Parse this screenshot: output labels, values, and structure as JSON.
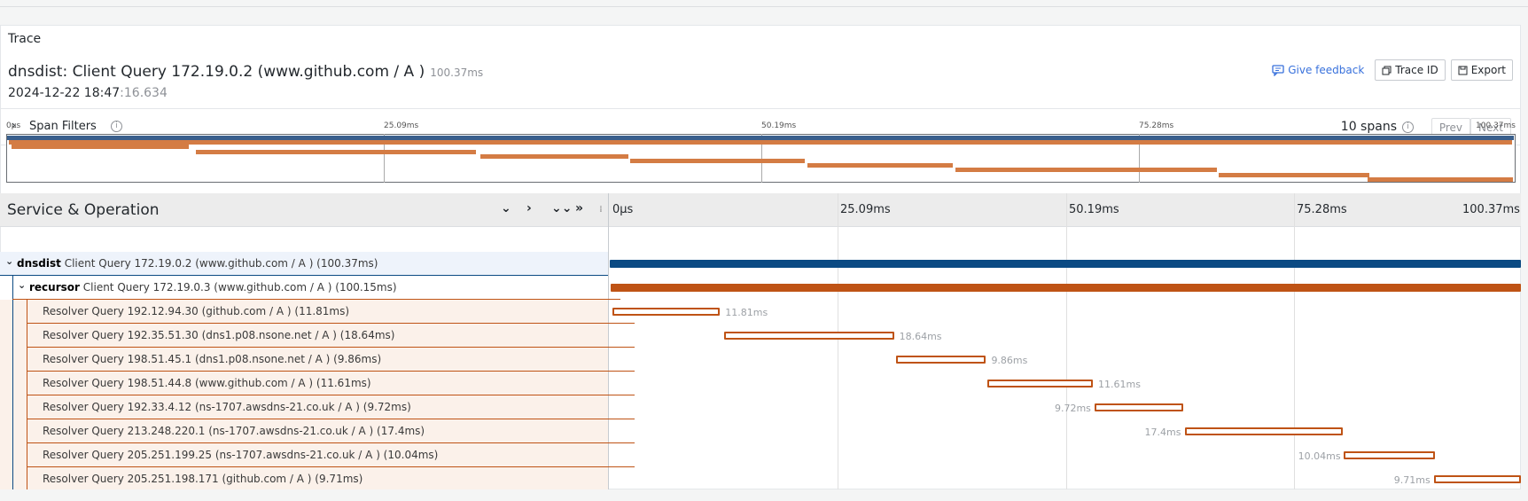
{
  "panel": {
    "title": "Trace"
  },
  "trace": {
    "title": "dnsdist: Client Query 172.19.0.2 (www.github.com / A )",
    "duration": "100.37ms",
    "date_main": "2024-12-22 18:47",
    "date_seconds": ":16.634"
  },
  "actions": {
    "feedback": "Give feedback",
    "trace_id": "Trace ID",
    "export": "Export"
  },
  "filters": {
    "label": "Span Filters",
    "span_count": "10 spans",
    "prev": "Prev",
    "next": "Next"
  },
  "ticks": [
    "0μs",
    "25.09ms",
    "50.19ms",
    "75.28ms",
    "100.37ms"
  ],
  "table": {
    "header": "Service & Operation"
  },
  "spans": [
    {
      "service": "dnsdist",
      "operation": "Client Query 172.19.0.2 (www.github.com / A ) (100.37ms)",
      "start": 0,
      "duration": 100.37,
      "label": "",
      "depth": 0
    },
    {
      "service": "recursor",
      "operation": "Client Query 172.19.0.3 (www.github.com / A ) (100.15ms)",
      "start": 0.1,
      "duration": 100.15,
      "label": "",
      "depth": 1
    },
    {
      "service": "",
      "operation": "Resolver Query 192.12.94.30 (github.com / A ) (11.81ms)",
      "start": 0.3,
      "duration": 11.81,
      "label": "11.81ms",
      "depth": 2
    },
    {
      "service": "",
      "operation": "Resolver Query 192.35.51.30 (dns1.p08.nsone.net / A ) (18.64ms)",
      "start": 12.6,
      "duration": 18.64,
      "label": "18.64ms",
      "depth": 2
    },
    {
      "service": "",
      "operation": "Resolver Query 198.51.45.1 (dns1.p08.nsone.net / A ) (9.86ms)",
      "start": 31.5,
      "duration": 9.86,
      "label": "9.86ms",
      "depth": 2
    },
    {
      "service": "",
      "operation": "Resolver Query 198.51.44.8 (www.github.com / A ) (11.61ms)",
      "start": 41.5,
      "duration": 11.61,
      "label": "11.61ms",
      "depth": 2
    },
    {
      "service": "",
      "operation": "Resolver Query 192.33.4.12 (ns-1707.awsdns-21.co.uk / A ) (9.72ms)",
      "start": 53.3,
      "duration": 9.72,
      "label": "9.72ms",
      "depth": 2
    },
    {
      "service": "",
      "operation": "Resolver Query 213.248.220.1 (ns-1707.awsdns-21.co.uk / A ) (17.4ms)",
      "start": 63.2,
      "duration": 17.4,
      "label": "17.4ms",
      "depth": 2
    },
    {
      "service": "",
      "operation": "Resolver Query 205.251.199.25 (ns-1707.awsdns-21.co.uk / A ) (10.04ms)",
      "start": 80.7,
      "duration": 10.04,
      "label": "10.04ms",
      "depth": 2
    },
    {
      "service": "",
      "operation": "Resolver Query 205.251.198.171 (github.com / A ) (9.71ms)",
      "start": 90.6,
      "duration": 9.71,
      "label": "9.71ms",
      "depth": 2
    }
  ],
  "colors": {
    "dnsdist": "#0b4a83",
    "recursor": "#bf5315",
    "minimap_root": "#3a5f8c",
    "minimap_child": "#d47c44"
  }
}
